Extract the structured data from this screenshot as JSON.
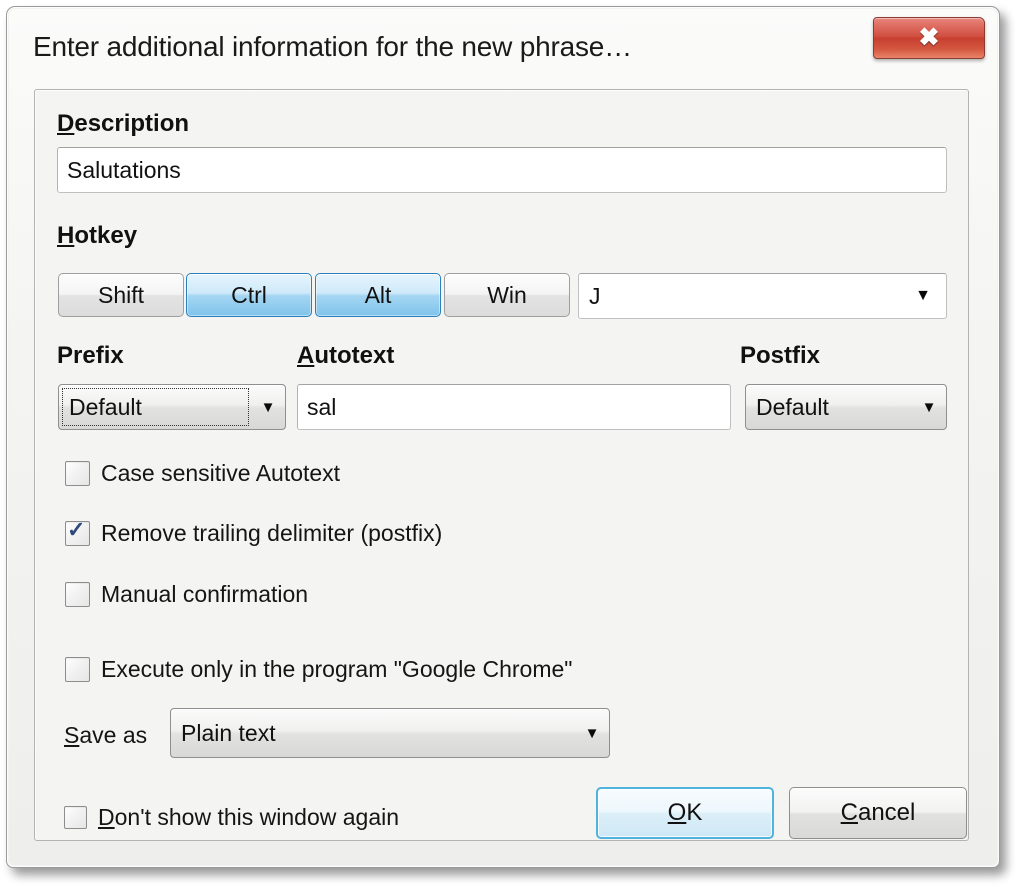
{
  "window": {
    "title": "Enter additional information for the new phrase…",
    "close_glyph": "✖",
    "accent_default_button": "#4fb3dd",
    "accent_toggle_on": "#7fc3ea",
    "close_button_color": "#c63f30"
  },
  "description": {
    "label_acc": "D",
    "label_rest": "escription",
    "value": "Salutations",
    "placeholder": ""
  },
  "hotkey": {
    "label_acc": "H",
    "label_rest": "otkey",
    "modifiers": [
      {
        "label": "Shift",
        "pressed": false
      },
      {
        "label": "Ctrl",
        "pressed": true
      },
      {
        "label": "Alt",
        "pressed": true
      },
      {
        "label": "Win",
        "pressed": false
      }
    ],
    "key_value": "J",
    "key_arrow": "▼"
  },
  "prefix": {
    "label": "Prefix",
    "value": "Default",
    "arrow": "▼",
    "focused": true
  },
  "autotext": {
    "label_acc": "A",
    "label_rest": "utotext",
    "value": "sal",
    "placeholder": ""
  },
  "postfix": {
    "label": "Postfix",
    "value": "Default",
    "arrow": "▼"
  },
  "options": [
    {
      "label": "Case sensitive Autotext",
      "checked": false
    },
    {
      "label": "Remove trailing delimiter (postfix)",
      "checked": true
    },
    {
      "label": "Manual confirmation",
      "checked": false
    },
    {
      "label": "Execute only in the program \"Google Chrome\"",
      "checked": false
    }
  ],
  "save_as": {
    "label_acc": "S",
    "label_rest": "ave as",
    "value": "Plain text",
    "arrow": "▼"
  },
  "footer": {
    "dont_show": {
      "label_acc": "D",
      "label_rest": "on't show this window again",
      "checked": false
    },
    "ok": {
      "acc": "O",
      "rest": "K"
    },
    "cancel": {
      "acc": "C",
      "rest": "ancel"
    }
  }
}
